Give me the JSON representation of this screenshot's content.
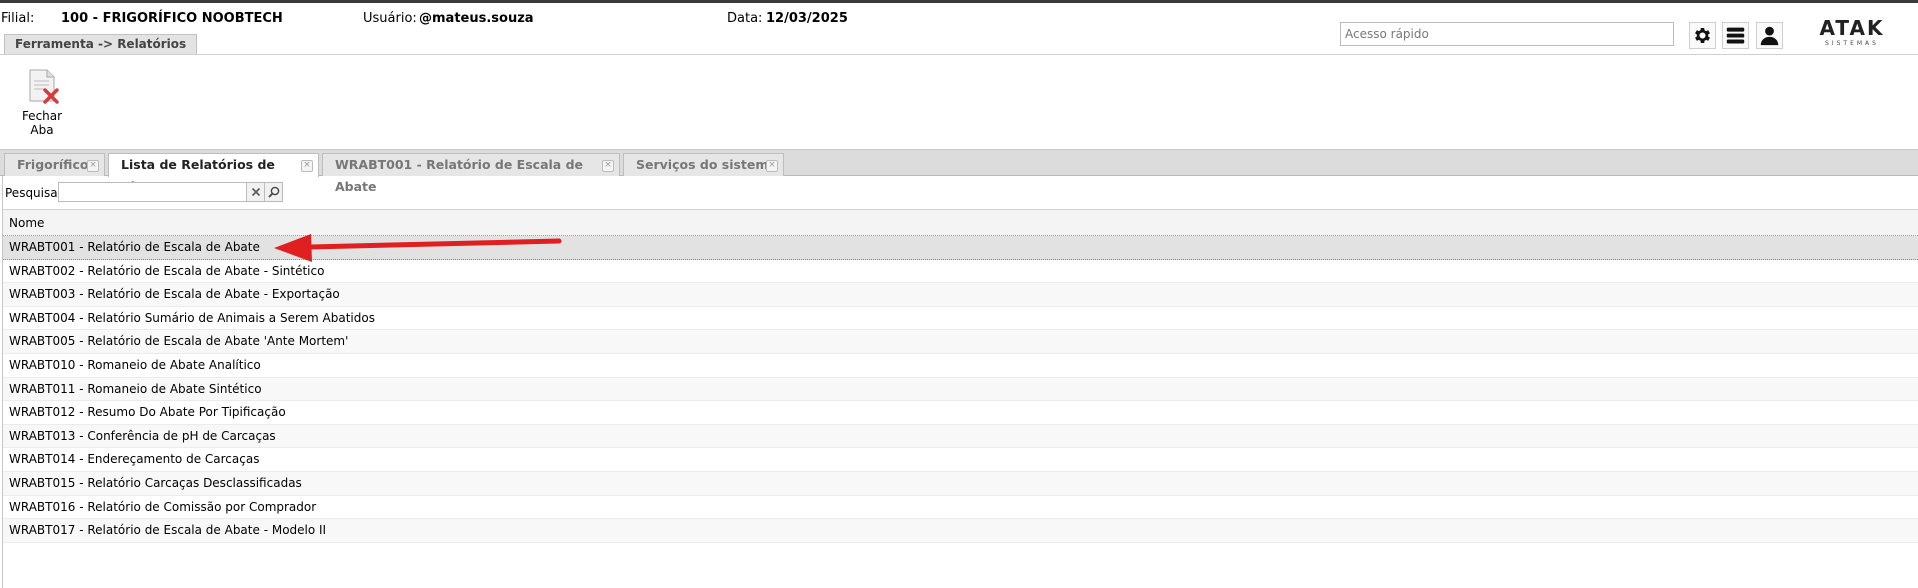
{
  "header": {
    "filial_label": "Filial:",
    "filial_value": "100 - FRIGORÍFICO NOOBTECH",
    "usuario_label": "Usuário:",
    "usuario_value": "@mateus.souza",
    "data_label": "Data:",
    "data_value": "12/03/2025",
    "breadcrumb": "Ferramenta -> Relatórios",
    "quick_access_placeholder": "Acesso rápido",
    "logo_text": "ATAK",
    "logo_sub": "SISTEMAS",
    "icons": [
      "gear-icon",
      "menu-icon",
      "user-icon"
    ]
  },
  "toolbar": {
    "close_tab_label": "Fechar Aba"
  },
  "tabs": [
    {
      "label": "Frigorífico",
      "active": false
    },
    {
      "label": "Lista de Relatórios de Abate",
      "active": true
    },
    {
      "label": "WRABT001 - Relatório de Escala de Abate",
      "active": false
    },
    {
      "label": "Serviços do sistema",
      "active": false
    }
  ],
  "search": {
    "label": "Pesquisar",
    "value": ""
  },
  "grid": {
    "column_header": "Nome",
    "selected_row": 0,
    "rows": [
      "WRABT001 - Relatório de Escala de Abate",
      "WRABT002 - Relatório de Escala de Abate - Sintético",
      "WRABT003 - Relatório de Escala de Abate - Exportação",
      "WRABT004 - Relatório Sumário de Animais a Serem Abatidos",
      "WRABT005 - Relatório de Escala de Abate 'Ante Mortem'",
      "WRABT010 - Romaneio de Abate Analítico",
      "WRABT011 - Romaneio de Abate Sintético",
      "WRABT012 - Resumo Do Abate Por Tipificação",
      "WRABT013 - Conferência de pH de Carcaças",
      "WRABT014 - Endereçamento de Carcaças",
      "WRABT015 - Relatório Carcaças Desclassificadas",
      "WRABT016 - Relatório de Comissão por Comprador",
      "WRABT017 - Relatório de Escala de Abate - Modelo II"
    ]
  },
  "colors": {
    "annotation_arrow": "#e02020",
    "tabbar_bg": "#dcdcdc",
    "selected_row_bg": "#e2e2e2"
  }
}
